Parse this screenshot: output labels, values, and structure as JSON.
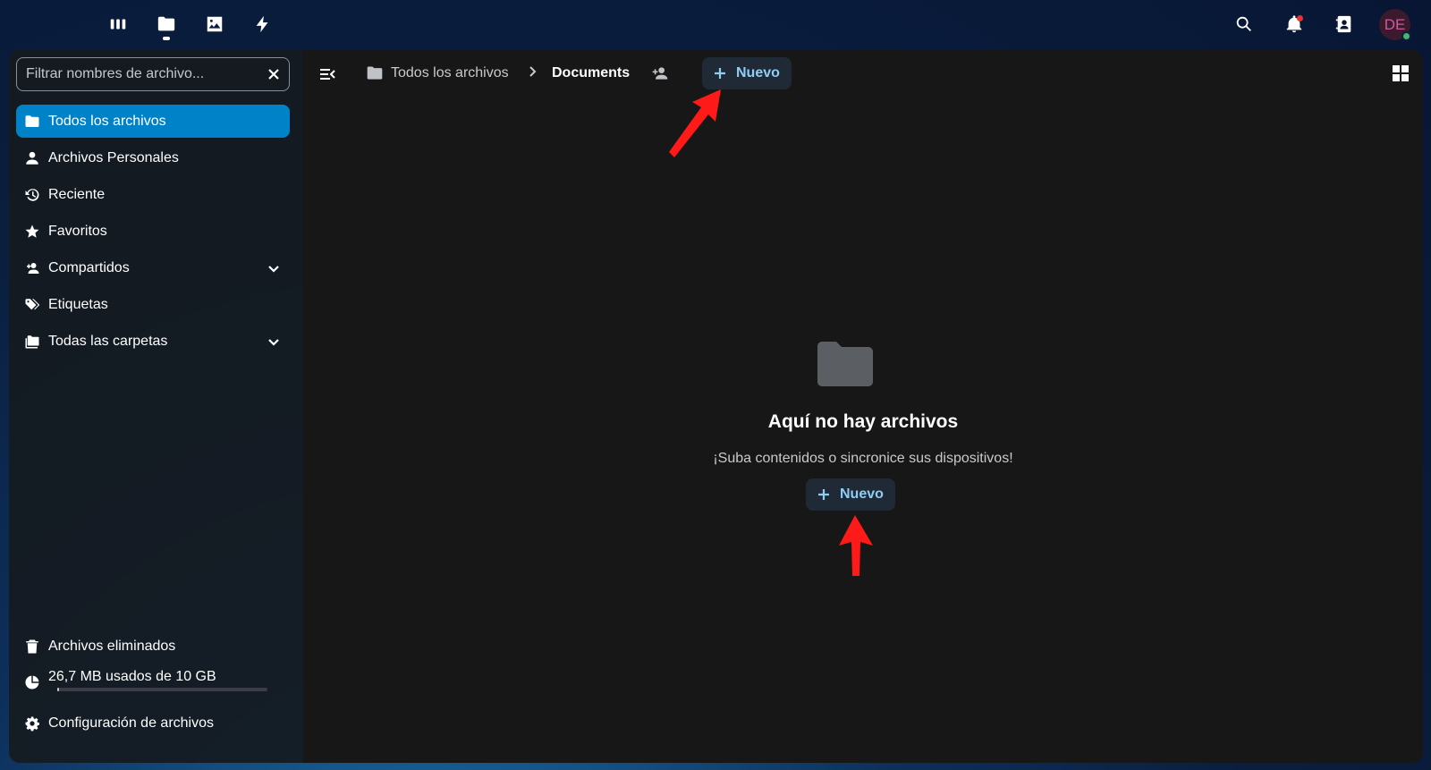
{
  "topbar": {
    "apps": [
      {
        "name": "dashboard",
        "icon": "dashboard-icon"
      },
      {
        "name": "files",
        "icon": "folder-icon",
        "active": true
      },
      {
        "name": "photos",
        "icon": "image-icon"
      },
      {
        "name": "activity",
        "icon": "bolt-icon"
      }
    ],
    "right_icons": [
      "search-icon",
      "bell-icon",
      "contacts-icon"
    ],
    "avatar_initials": "DE"
  },
  "sidebar": {
    "filter_placeholder": "Filtrar nombres de archivo...",
    "items": [
      {
        "label": "Todos los archivos",
        "icon": "folder-icon",
        "active": true
      },
      {
        "label": "Archivos Personales",
        "icon": "person-icon"
      },
      {
        "label": "Reciente",
        "icon": "history-icon"
      },
      {
        "label": "Favoritos",
        "icon": "star-icon"
      },
      {
        "label": "Compartidos",
        "icon": "share-icon",
        "expandable": true
      },
      {
        "label": "Etiquetas",
        "icon": "tag-icon"
      },
      {
        "label": "Todas las carpetas",
        "icon": "folders-icon",
        "expandable": true
      }
    ],
    "footer": {
      "trash_label": "Archivos eliminados",
      "quota_label": "26,7 MB usados de 10 GB",
      "quota_fraction": 0.003,
      "settings_label": "Configuración de archivos"
    }
  },
  "header": {
    "breadcrumb_root": "Todos los archivos",
    "breadcrumb_current": "Documents",
    "new_label": "Nuevo"
  },
  "empty_state": {
    "title": "Aquí no hay archivos",
    "subtitle": "¡Suba contenidos o sincronice sus dispositivos!",
    "new_label": "Nuevo"
  },
  "colors": {
    "accent": "#0082c9",
    "new_button_text": "#8fcdf5",
    "annotation_arrow": "#ff0000"
  }
}
